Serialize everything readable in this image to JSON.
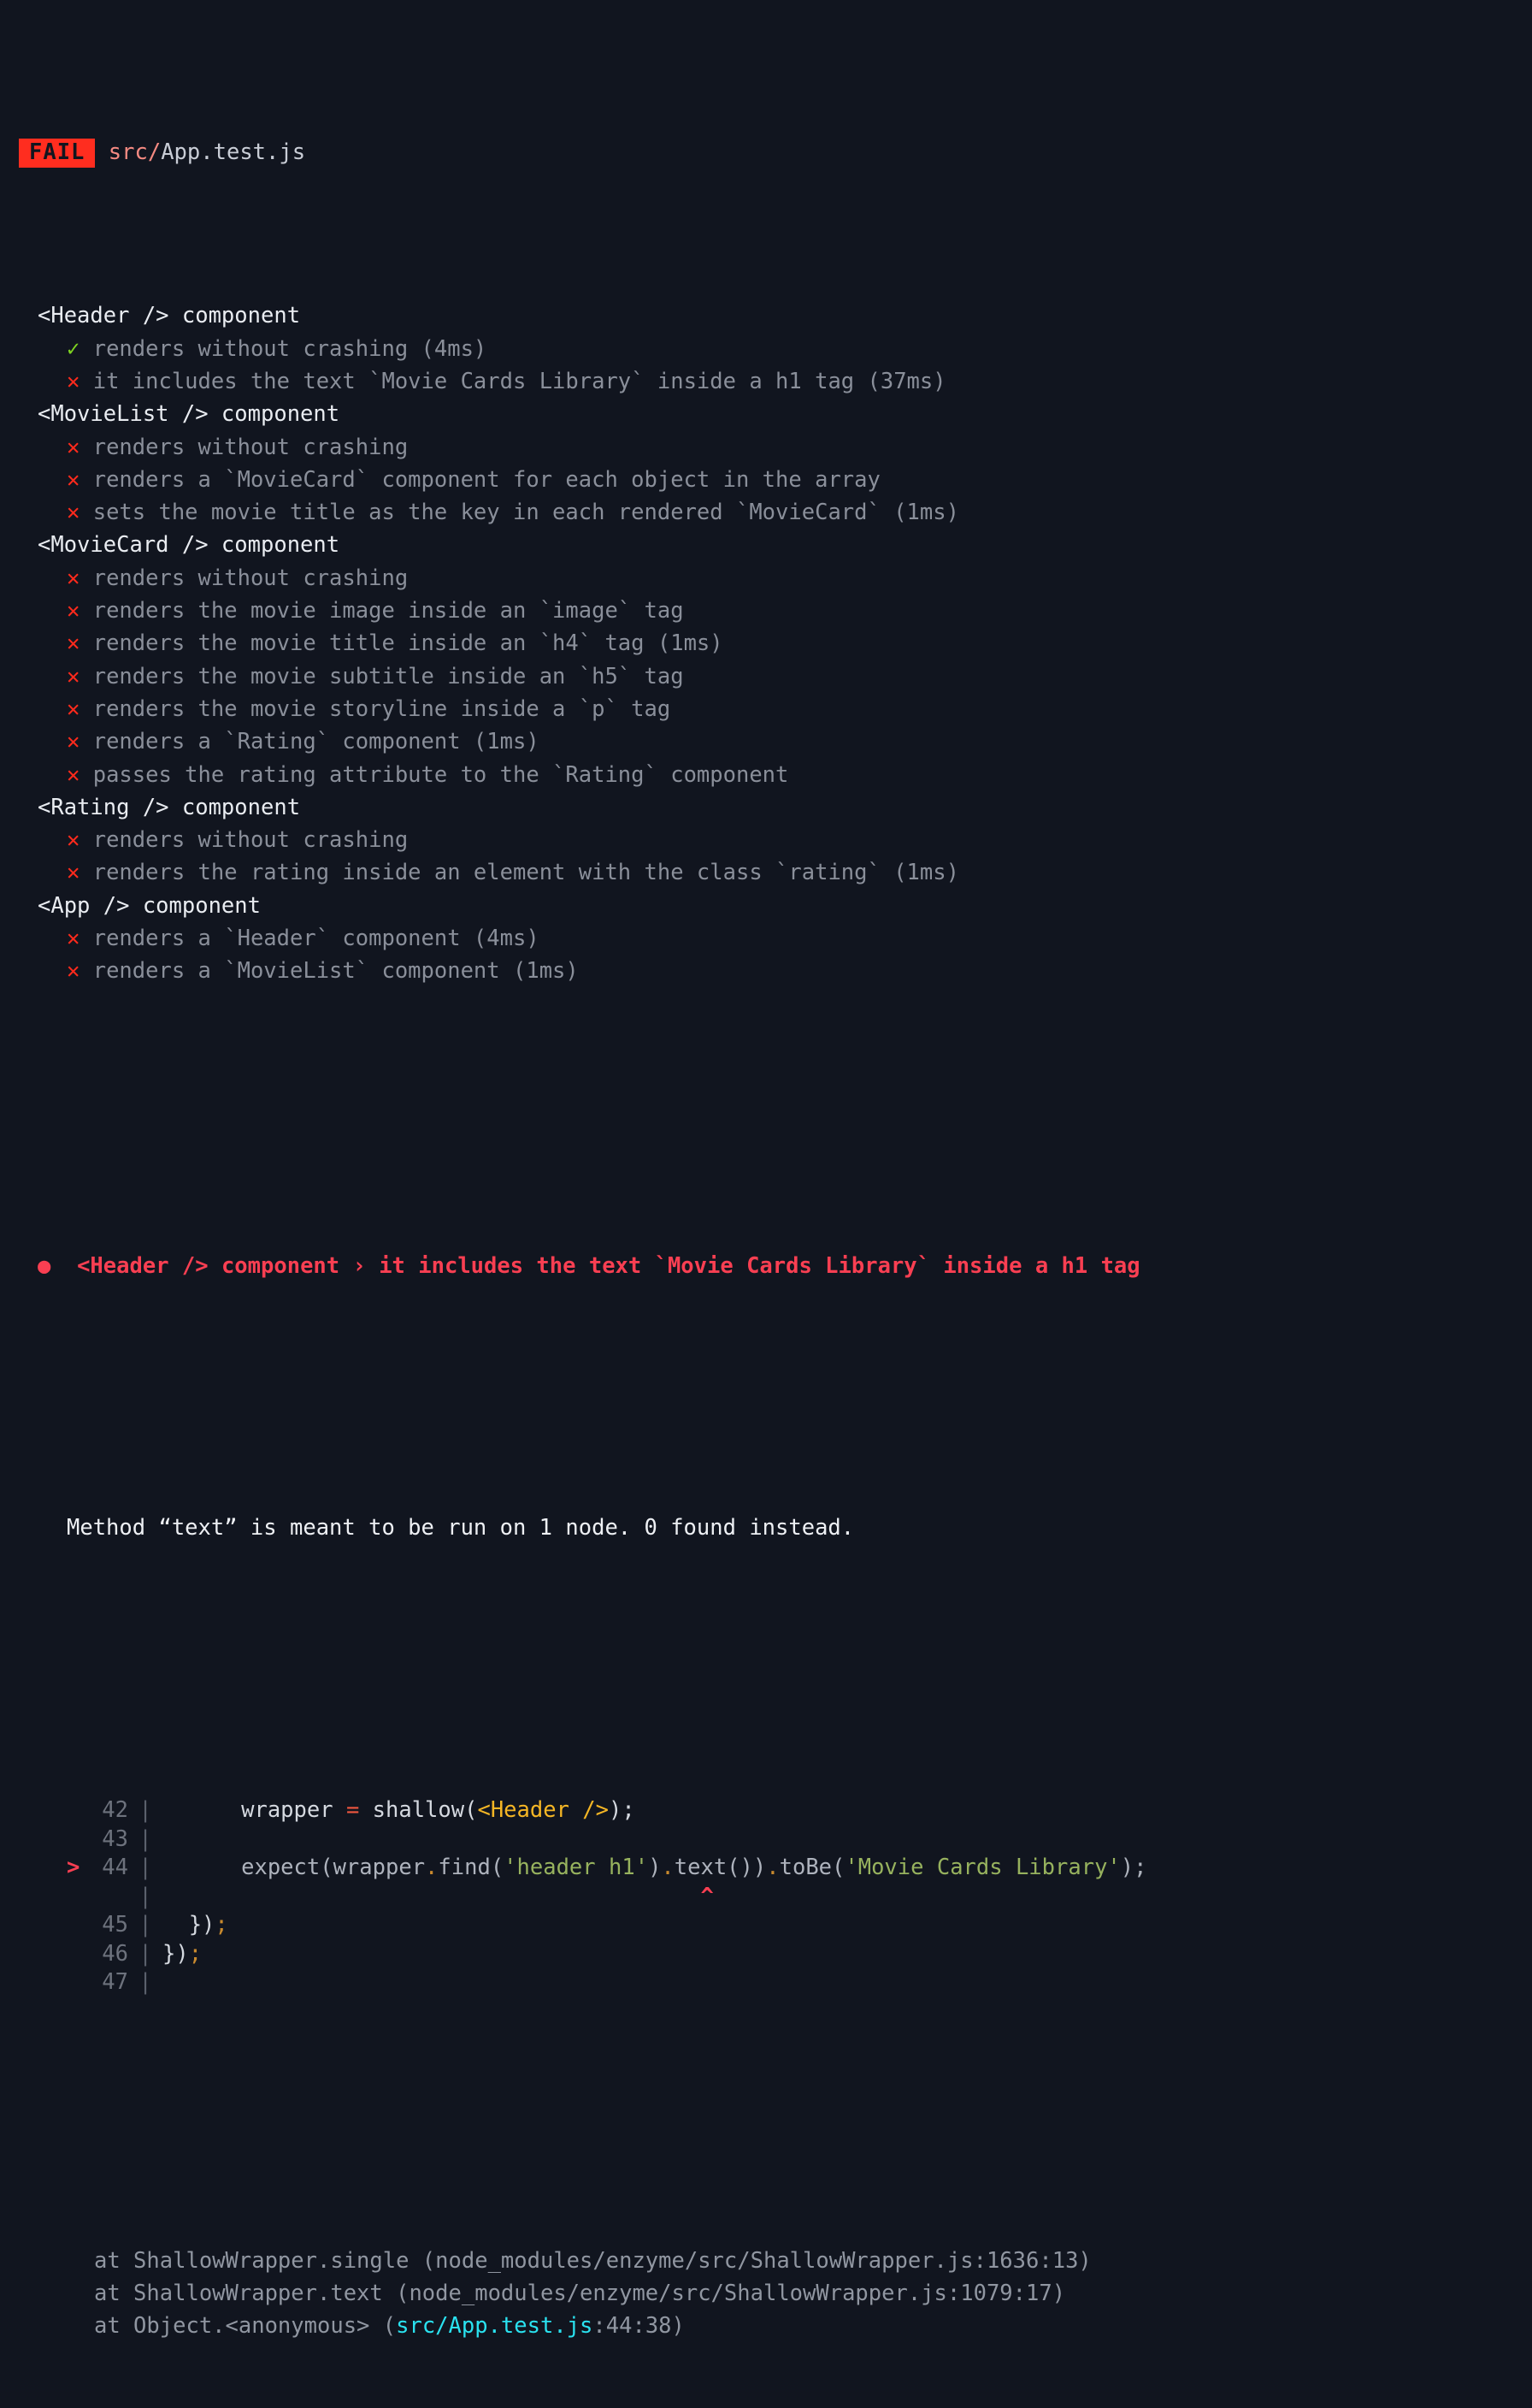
{
  "theme": {
    "background": "#11151f",
    "fail_badge_bg": "#ff2d1f",
    "fail_badge_fg": "#11151f",
    "pass_mark_color": "#7ed321",
    "fail_mark_color": "#ff2a1c",
    "failure_title_color": "#f93f52",
    "suite_text_color": "#e9ecf1",
    "test_text_color": "#8a8f9a",
    "string_token_color": "#97b25e",
    "tag_token_color": "#f5b625",
    "stack_highlight_color": "#2ae2f0"
  },
  "header": {
    "badge": "FAIL",
    "path_dir": "src/",
    "path_file": "App.test.js"
  },
  "marks": {
    "pass": "✓",
    "fail": "✕",
    "bullet": "●",
    "chevron": "›",
    "arrow": ">",
    "caret": "^",
    "pipe": "|"
  },
  "suites": [
    {
      "name": "<Header /> component",
      "tests": [
        {
          "status": "pass",
          "text": "renders without crashing (4ms)"
        },
        {
          "status": "fail",
          "text": "it includes the text `Movie Cards Library` inside a h1 tag (37ms)"
        }
      ]
    },
    {
      "name": "<MovieList /> component",
      "tests": [
        {
          "status": "fail",
          "text": "renders without crashing"
        },
        {
          "status": "fail",
          "text": "renders a `MovieCard` component for each object in the array"
        },
        {
          "status": "fail",
          "text": "sets the movie title as the key in each rendered `MovieCard` (1ms)"
        }
      ]
    },
    {
      "name": "<MovieCard /> component",
      "tests": [
        {
          "status": "fail",
          "text": "renders without crashing"
        },
        {
          "status": "fail",
          "text": "renders the movie image inside an `image` tag"
        },
        {
          "status": "fail",
          "text": "renders the movie title inside an `h4` tag (1ms)"
        },
        {
          "status": "fail",
          "text": "renders the movie subtitle inside an `h5` tag"
        },
        {
          "status": "fail",
          "text": "renders the movie storyline inside a `p` tag"
        },
        {
          "status": "fail",
          "text": "renders a `Rating` component (1ms)"
        },
        {
          "status": "fail",
          "text": "passes the rating attribute to the `Rating` component"
        }
      ]
    },
    {
      "name": "<Rating /> component",
      "tests": [
        {
          "status": "fail",
          "text": "renders without crashing"
        },
        {
          "status": "fail",
          "text": "renders the rating inside an element with the class `rating` (1ms)"
        }
      ]
    },
    {
      "name": "<App /> component",
      "tests": [
        {
          "status": "fail",
          "text": "renders a `Header` component (4ms)"
        },
        {
          "status": "fail",
          "text": "renders a `MovieList` component (1ms)"
        }
      ]
    }
  ],
  "failure": {
    "suite": "<Header /> component",
    "separator": "›",
    "test": "it includes the text `Movie Cards Library` inside a h1 tag",
    "message": "Method “text” is meant to be run on 1 node. 0 found instead.",
    "code_frame": [
      {
        "current": false,
        "lineno": "42",
        "tokens": [
          {
            "cls": "tok-plain",
            "t": "      wrapper "
          },
          {
            "cls": "tok-op",
            "t": "="
          },
          {
            "cls": "tok-plain",
            "t": " shallow("
          },
          {
            "cls": "tok-tag",
            "t": "<Header />"
          },
          {
            "cls": "tok-plain",
            "t": ");"
          }
        ]
      },
      {
        "current": false,
        "lineno": "43",
        "tokens": []
      },
      {
        "current": true,
        "lineno": "44",
        "tokens": [
          {
            "cls": "tok-dim",
            "t": "      expect(wrapper"
          },
          {
            "cls": "tok-punc",
            "t": "."
          },
          {
            "cls": "tok-dim",
            "t": "find("
          },
          {
            "cls": "tok-string",
            "t": "'header h1'"
          },
          {
            "cls": "tok-dim",
            "t": ")"
          },
          {
            "cls": "tok-punc",
            "t": "."
          },
          {
            "cls": "tok-dim",
            "t": "text())"
          },
          {
            "cls": "tok-punc",
            "t": "."
          },
          {
            "cls": "tok-dim",
            "t": "toBe("
          },
          {
            "cls": "tok-string",
            "t": "'Movie Cards Library'"
          },
          {
            "cls": "tok-dim",
            "t": ");"
          }
        ]
      },
      {
        "current": false,
        "lineno": "",
        "caret_col": 41,
        "tokens": []
      },
      {
        "current": false,
        "lineno": "45",
        "tokens": [
          {
            "cls": "tok-plain",
            "t": "  })"
          },
          {
            "cls": "tok-punc",
            "t": ";"
          }
        ]
      },
      {
        "current": false,
        "lineno": "46",
        "tokens": [
          {
            "cls": "tok-plain",
            "t": "})"
          },
          {
            "cls": "tok-punc",
            "t": ";"
          }
        ]
      },
      {
        "current": false,
        "lineno": "47",
        "tokens": []
      }
    ],
    "stack": [
      {
        "prefix": "at ShallowWrapper.single (node_modules/enzyme/src/ShallowWrapper.js:1636:13)",
        "highlight": "",
        "suffix": ""
      },
      {
        "prefix": "at ShallowWrapper.text (node_modules/enzyme/src/ShallowWrapper.js:1079:17)",
        "highlight": "",
        "suffix": ""
      },
      {
        "prefix": "at Object.<anonymous> (",
        "highlight": "src/App.test.js",
        "suffix": ":44:38)"
      }
    ]
  }
}
